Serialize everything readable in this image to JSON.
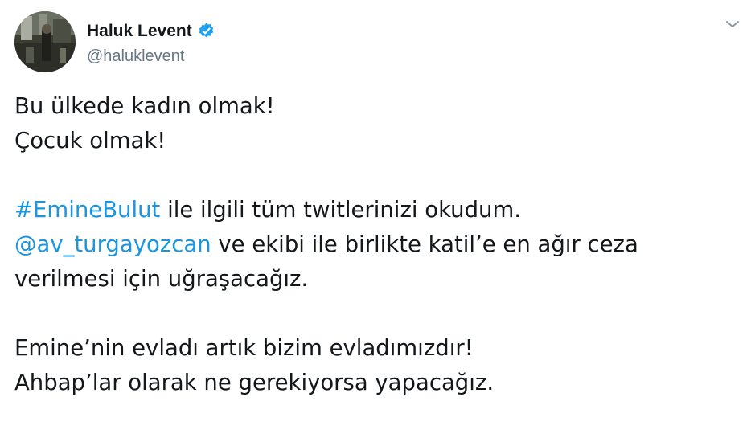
{
  "user": {
    "display_name": "Haluk Levent",
    "handle": "@haluklevent",
    "verified": true
  },
  "icons": {
    "avatar": "profile-photo",
    "verified": "verified-badge-icon",
    "menu": "chevron-down-icon"
  },
  "colors": {
    "link": "#1b95e0",
    "text": "#14171a",
    "secondary": "#657786",
    "verified_badge": "#1da1f2"
  },
  "tweet": {
    "line1": "Bu ülkede kadın olmak!",
    "line2": "Çocuk olmak!",
    "line3_hashtag": "#EmineBulut",
    "line3_rest": " ile ilgili tüm twitlerinizi okudum.",
    "line4_mention": "@av_turgayozcan",
    "line4_rest": " ve ekibi ile birlikte katil’e en ağır ceza",
    "line5": "verilmesi için uğraşacağız.",
    "line6": "Emine’nin evladı artık bizim evladımızdır!",
    "line7": "Ahbap’lar olarak ne gerekiyorsa yapacağız."
  }
}
